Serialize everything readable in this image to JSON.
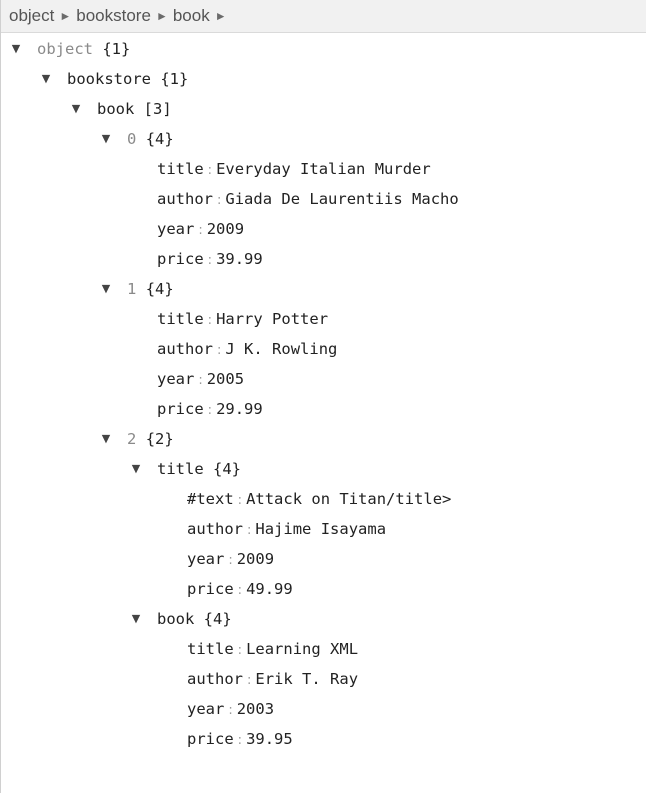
{
  "breadcrumb": {
    "items": [
      "object",
      "bookstore",
      "book"
    ],
    "separator": "►"
  },
  "icons": {
    "expanded": "▼"
  },
  "tree": {
    "root": {
      "key": "object",
      "count": "{1}"
    },
    "bookstore": {
      "key": "bookstore",
      "count": "{1}"
    },
    "book": {
      "key": "book",
      "count": "[3]"
    },
    "item0": {
      "key": "0",
      "count": "{4}",
      "title": {
        "key": "title",
        "value": "Everyday Italian Murder"
      },
      "author": {
        "key": "author",
        "value": "Giada De Laurentiis Macho"
      },
      "year": {
        "key": "year",
        "value": "2009"
      },
      "price": {
        "key": "price",
        "value": "39.99"
      }
    },
    "item1": {
      "key": "1",
      "count": "{4}",
      "title": {
        "key": "title",
        "value": "Harry Potter"
      },
      "author": {
        "key": "author",
        "value": "J K. Rowling"
      },
      "year": {
        "key": "year",
        "value": "2005"
      },
      "price": {
        "key": "price",
        "value": "29.99"
      }
    },
    "item2": {
      "key": "2",
      "count": "{2}",
      "title_obj": {
        "key": "title",
        "count": "{4}",
        "text": {
          "key": "#text",
          "value": "Attack on Titan/title>"
        },
        "author": {
          "key": "author",
          "value": "Hajime Isayama"
        },
        "year": {
          "key": "year",
          "value": "2009"
        },
        "price": {
          "key": "price",
          "value": "49.99"
        }
      },
      "book_obj": {
        "key": "book",
        "count": "{4}",
        "title": {
          "key": "title",
          "value": "Learning XML"
        },
        "author": {
          "key": "author",
          "value": "Erik T. Ray"
        },
        "year": {
          "key": "year",
          "value": "2003"
        },
        "price": {
          "key": "price",
          "value": "39.95"
        }
      }
    }
  }
}
